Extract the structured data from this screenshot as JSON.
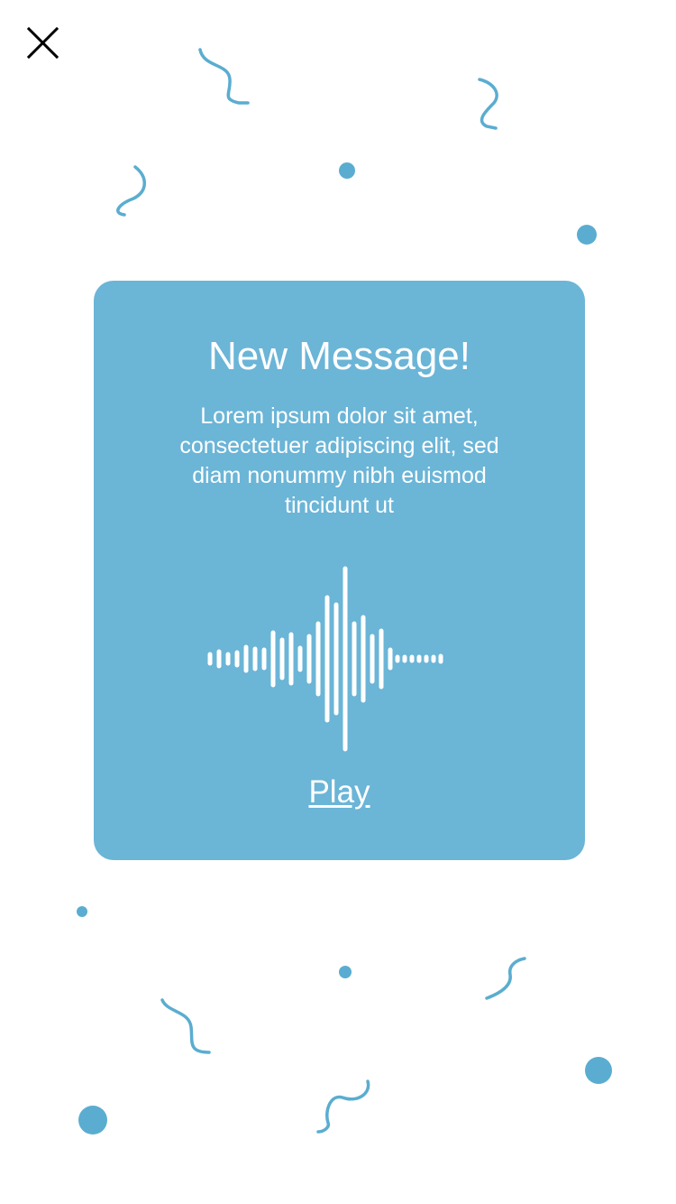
{
  "colors": {
    "accent": "#6bb5d7",
    "decor": "#5aadd0",
    "text_on_card": "#ffffff",
    "close_icon": "#000000"
  },
  "header": {
    "close_icon": "close-icon"
  },
  "message_card": {
    "title": "New Message!",
    "body": "Lorem ipsum dolor sit amet, consectetuer adipiscing elit, sed diam nonummy nibh euismod tincidunt ut",
    "waveform_icon": "audio-waveform-icon",
    "play_label": "Play"
  }
}
